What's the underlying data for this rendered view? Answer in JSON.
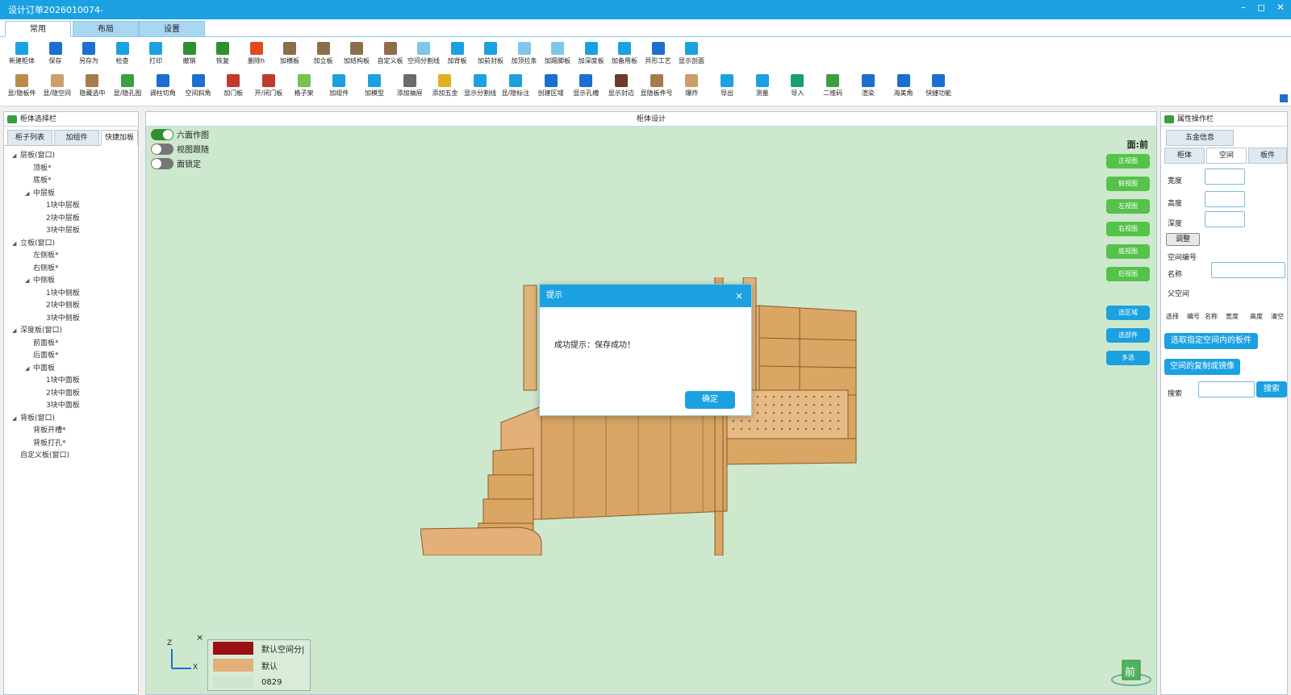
{
  "window": {
    "title": "设计订单2026010074-",
    "controls": [
      "–",
      "◻",
      "✕"
    ]
  },
  "tabs": [
    {
      "label": "常用",
      "active": true
    },
    {
      "label": "布局",
      "active": false
    },
    {
      "label": "设置",
      "active": false
    }
  ],
  "toolbar": {
    "row1": [
      {
        "label": "新建柜体",
        "icon": "new-cabinet-icon",
        "color": "#1ba1e2"
      },
      {
        "label": "保存",
        "icon": "save-icon",
        "color": "#1b6fd0"
      },
      {
        "label": "另存为",
        "icon": "save-as-icon",
        "color": "#1b6fd0"
      },
      {
        "label": "检查",
        "icon": "check-icon",
        "color": "#1ba1e2"
      },
      {
        "label": "打印",
        "icon": "print-icon",
        "color": "#1ba1e2"
      },
      {
        "label": "撤销",
        "icon": "undo-icon",
        "color": "#2f8f2f"
      },
      {
        "label": "恢复",
        "icon": "redo-icon",
        "color": "#2f8f2f"
      },
      {
        "label": "删除h",
        "icon": "delete-icon",
        "color": "#e24a1b"
      },
      {
        "label": "加横板",
        "icon": "add-horizontal-board-icon",
        "color": "#8d6e4a"
      },
      {
        "label": "加立板",
        "icon": "add-vertical-board-icon",
        "color": "#8d6e4a"
      },
      {
        "label": "加结构板",
        "icon": "add-structure-board-icon",
        "color": "#8d6e4a"
      },
      {
        "label": "自定义板",
        "icon": "custom-board-icon",
        "color": "#8d6e4a"
      },
      {
        "label": "空间分割线",
        "icon": "space-divider-icon",
        "color": "#7fc6ea"
      },
      {
        "label": "加背板",
        "icon": "add-back-board-icon",
        "color": "#1ba1e2"
      },
      {
        "label": "加前封板",
        "icon": "add-front-seal-icon",
        "color": "#1ba1e2"
      },
      {
        "label": "加顶拉条",
        "icon": "add-top-strip-icon",
        "color": "#7fc6ea"
      },
      {
        "label": "加踢脚板",
        "icon": "add-kickboard-icon",
        "color": "#7fc6ea"
      },
      {
        "label": "加深度板",
        "icon": "add-depth-board-icon",
        "color": "#1ba1e2"
      },
      {
        "label": "加备用板",
        "icon": "add-spare-board-icon",
        "color": "#1ba1e2"
      },
      {
        "label": "异形工艺",
        "icon": "shaped-process-icon",
        "color": "#1b6fd0"
      },
      {
        "label": "显示剖面",
        "icon": "show-section-icon",
        "color": "#1ba1e2"
      }
    ],
    "row2": [
      {
        "label": "显/隐板件",
        "icon": "toggle-boards-icon",
        "color": "#b98a4c"
      },
      {
        "label": "显/隐空间",
        "icon": "toggle-space-icon",
        "color": "#c9a06a"
      },
      {
        "label": "隐藏选中",
        "icon": "hide-selected-icon",
        "color": "#a57c4d"
      },
      {
        "label": "显/隐孔图",
        "icon": "toggle-holes-icon",
        "color": "#3b9e3f"
      },
      {
        "label": "调柱切角",
        "icon": "column-corner-icon",
        "color": "#1b6fd0"
      },
      {
        "label": "空间斜角",
        "icon": "space-bevel-icon",
        "color": "#1b6fd0"
      },
      {
        "label": "加门板",
        "icon": "add-door-icon",
        "color": "#c0392b"
      },
      {
        "label": "开/闭门板",
        "icon": "open-close-door-icon",
        "color": "#c0392b"
      },
      {
        "label": "格子架",
        "icon": "grid-rack-icon",
        "color": "#7bbf55"
      },
      {
        "label": "加组件",
        "icon": "add-component-icon",
        "color": "#1ba1e2"
      },
      {
        "label": "加模型",
        "icon": "add-model-icon",
        "color": "#1ba1e2"
      },
      {
        "label": "添加抽屉",
        "icon": "add-drawer-icon",
        "color": "#6a6a6a"
      },
      {
        "label": "添加五金",
        "icon": "add-hardware-icon",
        "color": "#e0b020"
      },
      {
        "label": "显示分割线",
        "icon": "show-divider-icon",
        "color": "#1ba1e2"
      },
      {
        "label": "显/隐标注",
        "icon": "toggle-annotation-icon",
        "color": "#1ba1e2"
      },
      {
        "label": "创建区域",
        "icon": "create-region-icon",
        "color": "#1b6fd0"
      },
      {
        "label": "显示孔槽",
        "icon": "show-slots-icon",
        "color": "#1b6fd0"
      },
      {
        "label": "显示封边",
        "icon": "show-edge-icon",
        "color": "#6b3a2a"
      },
      {
        "label": "显隐板件号",
        "icon": "toggle-board-number-icon",
        "color": "#a57c4d"
      },
      {
        "label": "爆炸",
        "icon": "explode-icon",
        "color": "#c9a06a"
      },
      {
        "label": "导出",
        "icon": "export-icon",
        "color": "#1ba1e2"
      },
      {
        "label": "测量",
        "icon": "measure-icon",
        "color": "#1ba1e2"
      },
      {
        "label": "导入",
        "icon": "import-icon",
        "color": "#1b9e6f"
      },
      {
        "label": "二维码",
        "icon": "qr-cloud-icon",
        "color": "#3b9e3f"
      },
      {
        "label": "渲染",
        "icon": "render-icon",
        "color": "#1b6fd0"
      },
      {
        "label": "海美角",
        "icon": "corner-icon",
        "color": "#1b6fd0"
      },
      {
        "label": "快捷功能",
        "icon": "quick-function-icon",
        "color": "#1b6fd0"
      }
    ]
  },
  "left_panel": {
    "title": "柜体选择栏",
    "tabs": [
      {
        "label": "柜子列表",
        "active": false
      },
      {
        "label": "加组件",
        "active": false
      },
      {
        "label": "快捷加板",
        "active": true
      }
    ],
    "tree": [
      {
        "label": "层板(窗口)",
        "level": 0,
        "expand": true
      },
      {
        "label": "顶板*",
        "level": 1
      },
      {
        "label": "底板*",
        "level": 1
      },
      {
        "label": "中层板",
        "level": 1,
        "expand": true
      },
      {
        "label": "1块中层板",
        "level": 2
      },
      {
        "label": "2块中层板",
        "level": 2
      },
      {
        "label": "3块中层板",
        "level": 2
      },
      {
        "label": "立板(窗口)",
        "level": 0,
        "expand": true
      },
      {
        "label": "左侧板*",
        "level": 1
      },
      {
        "label": "右侧板*",
        "level": 1
      },
      {
        "label": "中侧板",
        "level": 1,
        "expand": true
      },
      {
        "label": "1块中侧板",
        "level": 2
      },
      {
        "label": "2块中侧板",
        "level": 2
      },
      {
        "label": "3块中侧板",
        "level": 2
      },
      {
        "label": "深度板(窗口)",
        "level": 0,
        "expand": true
      },
      {
        "label": "前面板*",
        "level": 1
      },
      {
        "label": "后面板*",
        "level": 1
      },
      {
        "label": "中面板",
        "level": 1,
        "expand": true
      },
      {
        "label": "1块中面板",
        "level": 2
      },
      {
        "label": "2块中面板",
        "level": 2
      },
      {
        "label": "3块中面板",
        "level": 2
      },
      {
        "label": "背板(窗口)",
        "level": 0,
        "expand": true
      },
      {
        "label": "背板开槽*",
        "level": 1
      },
      {
        "label": "背板打孔*",
        "level": 1
      },
      {
        "label": "自定义板(窗口)",
        "level": 0
      }
    ]
  },
  "center": {
    "title": "柜体设计",
    "toggles": [
      {
        "label": "六面作图",
        "on": true
      },
      {
        "label": "视图跟随",
        "on": false
      },
      {
        "label": "面锁定",
        "on": false
      }
    ],
    "face_label": "面:前",
    "view_buttons": [
      "正视图",
      "俯视图",
      "左视图",
      "右视图",
      "底视图",
      "后视图"
    ],
    "select_buttons": [
      "选区域",
      "选部件",
      "多选"
    ],
    "axis": {
      "z": "Z",
      "x": "X"
    },
    "legend_close": "×",
    "legend": [
      {
        "label": "默认空间分|",
        "color": "#9b1111"
      },
      {
        "label": "默认",
        "color": "#e3b07a"
      },
      {
        "label": "0829",
        "color": "#cfe6cf"
      }
    ],
    "cube_label": "前"
  },
  "dialog": {
    "title": "提示",
    "close": "×",
    "message": "成功提示：保存成功！",
    "ok": "确定"
  },
  "right_panel": {
    "title": "属性操作栏",
    "tab_top": "五金信息",
    "tabs": [
      {
        "label": "柜体",
        "active": false
      },
      {
        "label": "空间",
        "active": true
      },
      {
        "label": "板件",
        "active": false
      }
    ],
    "fields": {
      "width": "宽度",
      "height": "高度",
      "depth": "深度"
    },
    "adjust": "调整",
    "space_number": "空间编号",
    "name_label": "名称",
    "parent_space": "父空间",
    "columns": [
      "选择",
      "编号",
      "名称",
      "宽度",
      "高度",
      "清空"
    ],
    "btn_select_boards": "选取指定空间内的板件",
    "btn_copy_mirror": "空间的复制或镜像",
    "search_label": "搜索",
    "search_button": "搜索"
  }
}
